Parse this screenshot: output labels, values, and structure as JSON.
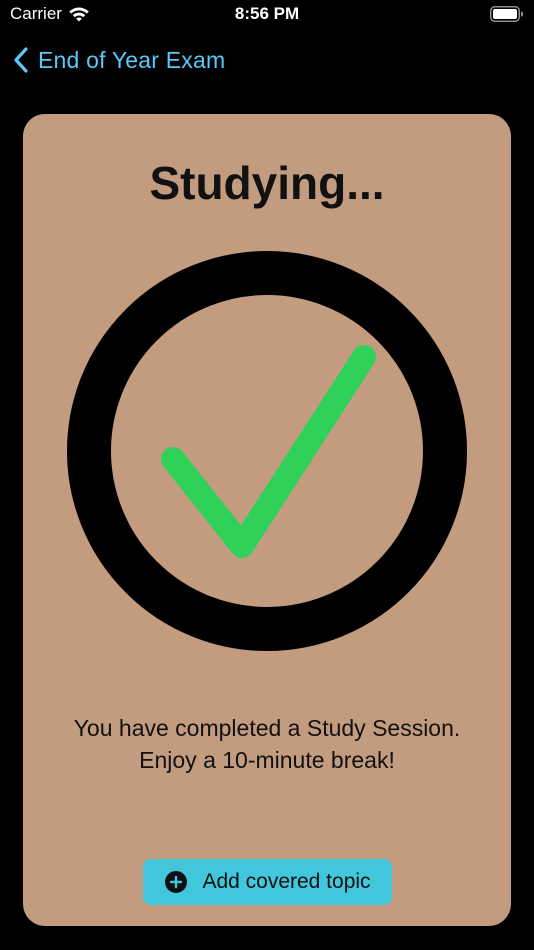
{
  "status_bar": {
    "carrier": "Carrier",
    "time": "8:56 PM",
    "wifi_icon": "wifi-icon",
    "battery_icon": "battery-icon"
  },
  "nav": {
    "back_label": "End of Year Exam",
    "back_icon": "chevron-left-icon"
  },
  "card": {
    "title": "Studying...",
    "status_icon": "checkmark-circle-icon",
    "message_line1": "You have completed a Study Session.",
    "message_line2": "Enjoy a 10-minute break!",
    "add_button_label": "Add covered topic",
    "add_button_icon": "plus-circle-icon"
  },
  "colors": {
    "background": "#000000",
    "card": "#c39b7f",
    "accent_blue": "#5ac8fa",
    "button": "#42c6dc",
    "check_green": "#30d158",
    "ring": "#000000"
  }
}
